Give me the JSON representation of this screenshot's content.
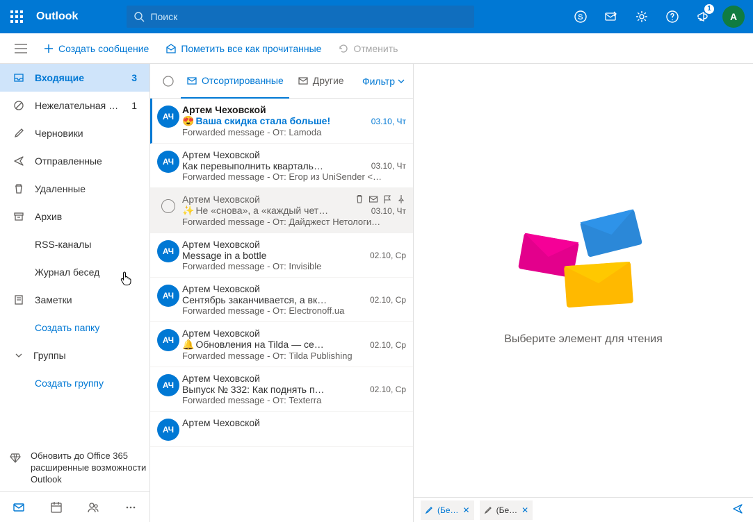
{
  "header": {
    "brand": "Outlook",
    "search_placeholder": "Поиск",
    "notif_count": "1",
    "avatar_initial": "A"
  },
  "cmd": {
    "compose": "Создать сообщение",
    "mark_all_read": "Пометить все как прочитанные",
    "undo": "Отменить"
  },
  "folders": [
    {
      "icon": "inbox",
      "label": "Входящие",
      "count": "3",
      "selected": true,
      "link": false,
      "sub": false
    },
    {
      "icon": "block",
      "label": "Нежелательная …",
      "count": "1",
      "selected": false,
      "link": false,
      "sub": false
    },
    {
      "icon": "draft",
      "label": "Черновики",
      "count": "",
      "selected": false,
      "link": false,
      "sub": false
    },
    {
      "icon": "send",
      "label": "Отправленные",
      "count": "",
      "selected": false,
      "link": false,
      "sub": false
    },
    {
      "icon": "trash",
      "label": "Удаленные",
      "count": "",
      "selected": false,
      "link": false,
      "sub": false
    },
    {
      "icon": "archive",
      "label": "Архив",
      "count": "",
      "selected": false,
      "link": false,
      "sub": false
    },
    {
      "icon": "",
      "label": "RSS-каналы",
      "count": "",
      "selected": false,
      "link": false,
      "sub": true
    },
    {
      "icon": "",
      "label": "Журнал бесед",
      "count": "",
      "selected": false,
      "link": false,
      "sub": true
    },
    {
      "icon": "note",
      "label": "Заметки",
      "count": "",
      "selected": false,
      "link": false,
      "sub": false
    },
    {
      "icon": "",
      "label": "Создать папку",
      "count": "",
      "selected": false,
      "link": true,
      "sub": true
    }
  ],
  "groups_header": "Группы",
  "create_group": "Создать группу",
  "upsell": "Обновить до Office 365 расширенные возможности Outlook",
  "list": {
    "tab_focused": "Отсортированные",
    "tab_other": "Другие",
    "filter": "Фильтр"
  },
  "avatar_initials": "АЧ",
  "messages": [
    {
      "sender": "Артем Чеховской",
      "subject_prefix": "😍",
      "subject": "Ваша скидка стала больше!",
      "date": "03.10, Чт",
      "preview": "Forwarded message - От: Lamoda <newsletter…",
      "unread": true,
      "hover": false
    },
    {
      "sender": "Артем Чеховской",
      "subject_prefix": "",
      "subject": "Как перевыполнить кварталь…",
      "date": "03.10, Чт",
      "preview": "Forwarded message - От: Егор из UniSender <…",
      "unread": false,
      "hover": false
    },
    {
      "sender": "Артем Чеховской",
      "subject_prefix": "✨",
      "subject": "Не «снова», а «каждый чет…",
      "date": "03.10, Чт",
      "preview": "Forwarded message - От: Дайджест Нетологи…",
      "unread": false,
      "hover": true
    },
    {
      "sender": "Артем Чеховской",
      "subject_prefix": "",
      "subject": "Message in a bottle",
      "date": "02.10, Ср",
      "preview": "Forwarded message - От: Invisible <info@invis…",
      "unread": false,
      "hover": false
    },
    {
      "sender": "Артем Чеховской",
      "subject_prefix": "",
      "subject": "Сентябрь заканчивается, а вк…",
      "date": "02.10, Ср",
      "preview": "Forwarded message - От: Electronoff.ua <sales…",
      "unread": false,
      "hover": false
    },
    {
      "sender": "Артем Чеховской",
      "subject_prefix": "🔔",
      "subject": "Обновления на Tilda — се…",
      "date": "02.10, Ср",
      "preview": "Forwarded message - От: Tilda Publishing <hel…",
      "unread": false,
      "hover": false
    },
    {
      "sender": "Артем Чеховской",
      "subject_prefix": "",
      "subject": "Выпуск № 332: Как поднять п…",
      "date": "02.10, Ср",
      "preview": "Forwarded message - От: Texterra <partizan@…",
      "unread": false,
      "hover": false
    },
    {
      "sender": "Артем Чеховской",
      "subject_prefix": "",
      "subject": "",
      "date": "",
      "preview": "",
      "unread": false,
      "hover": false
    }
  ],
  "empty_text": "Выберите элемент для чтения",
  "drafts": [
    {
      "label": "(Бе…",
      "active": true
    },
    {
      "label": "(Бе…",
      "active": false
    }
  ]
}
